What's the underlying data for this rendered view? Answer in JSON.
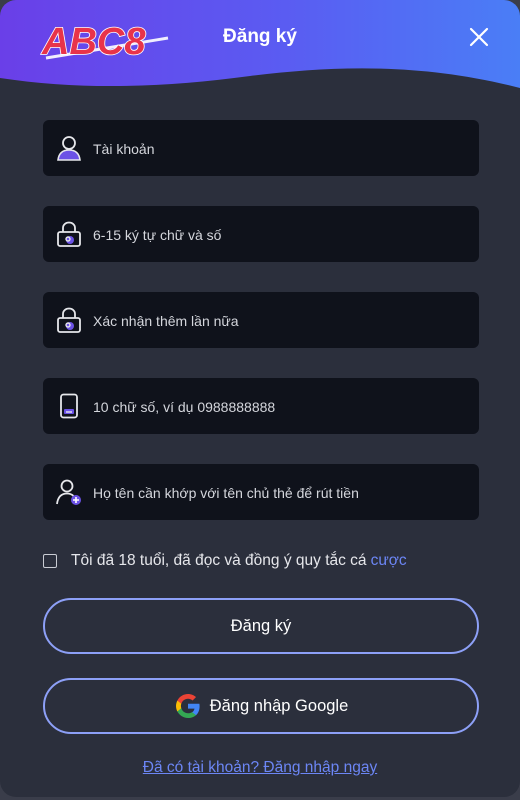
{
  "header": {
    "logo_text": "ABC8",
    "title": "Đăng ký",
    "close_icon": "close-icon"
  },
  "form": {
    "fields": [
      {
        "icon": "user-icon",
        "placeholder": "Tài khoản",
        "value": ""
      },
      {
        "icon": "lock-icon",
        "placeholder": "6-15 ký tự chữ và số",
        "value": ""
      },
      {
        "icon": "lock-icon",
        "placeholder": "Xác nhận thêm lần nữa",
        "value": ""
      },
      {
        "icon": "phone-icon",
        "placeholder": "10 chữ số, ví dụ 0988888888",
        "value": ""
      },
      {
        "icon": "add-user-icon",
        "placeholder": "Họ tên cần khớp với tên chủ thẻ để rút tiền",
        "value": ""
      }
    ],
    "agree_text": "Tôi đã 18 tuổi, đã đọc và đồng ý quy tắc cá",
    "agree_link": "cược",
    "agree_checked": false,
    "register_button": "Đăng ký",
    "google_button": "Đăng nhập Google"
  },
  "footer": {
    "login_link": "Đã có tài khoản? Đăng nhập ngay"
  },
  "colors": {
    "header_gradient_start": "#6d4df2",
    "header_gradient_end": "#4a6cf7",
    "background": "#2b2f3c",
    "input_bg": "#0f121b",
    "button_border": "#8da0f7",
    "link": "#6c86f5",
    "logo": "#e8334a"
  }
}
